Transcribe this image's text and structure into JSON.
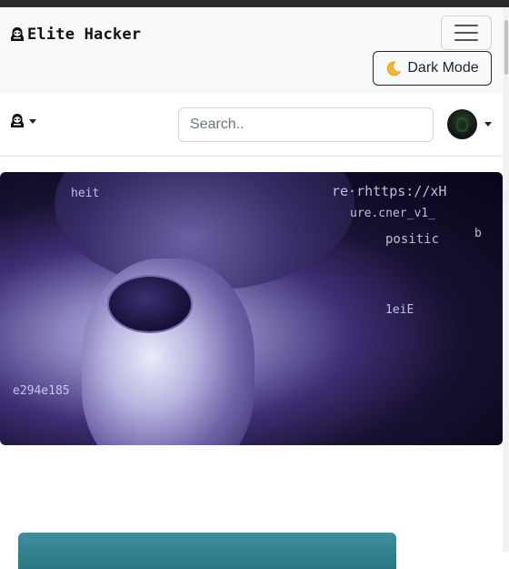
{
  "navbar": {
    "brand": "Elite Hacker",
    "dark_mode_label": "Dark Mode"
  },
  "subnav": {
    "search_placeholder": "Search.."
  },
  "hero": {
    "code_text": [
      "heit",
      "re·rhttps://xH",
      "ure.cner_v1_",
      "positic",
      "b",
      "e294e185",
      "1eiE"
    ]
  },
  "icons": {
    "brand": "hacker-icon",
    "toggler": "hamburger-icon",
    "dark_mode": "moon-icon",
    "user_menu": "hacker-icon",
    "profile": "avatar"
  },
  "colors": {
    "navbar_bg": "#f8f9fa",
    "text": "#212529",
    "hero_accent": "#3e2e74"
  }
}
